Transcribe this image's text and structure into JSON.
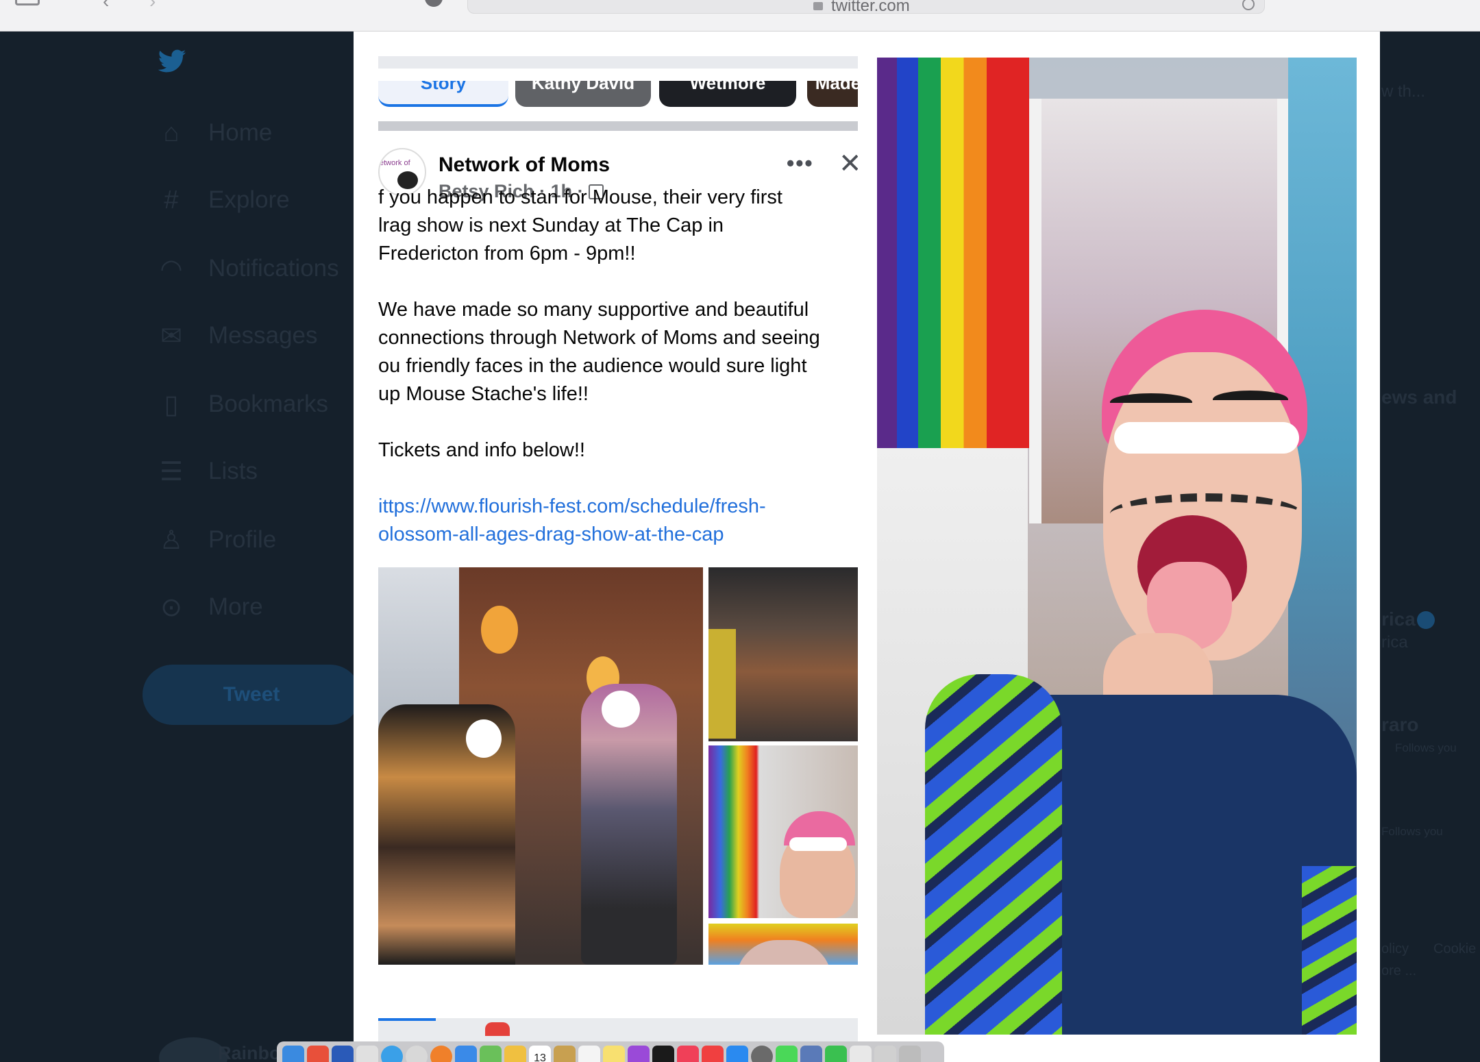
{
  "browser": {
    "url": "twitter.com",
    "icons": [
      "sidebar-icon",
      "back-icon",
      "forward-icon",
      "shield-icon",
      "lock-icon",
      "reload-icon"
    ]
  },
  "twitter": {
    "nav": [
      {
        "label": "Home",
        "icon": "home-icon"
      },
      {
        "label": "Explore",
        "icon": "hashtag-icon"
      },
      {
        "label": "Notifications",
        "icon": "bell-icon"
      },
      {
        "label": "Messages",
        "icon": "envelope-icon"
      },
      {
        "label": "Bookmarks",
        "icon": "bookmark-icon"
      },
      {
        "label": "Lists",
        "icon": "list-icon"
      },
      {
        "label": "Profile",
        "icon": "person-icon"
      },
      {
        "label": "More",
        "icon": "more-circle-icon"
      }
    ],
    "tweet_button": "Tweet",
    "account_name": "Rainbo",
    "right_fragments": {
      "f1": "w th...",
      "news": "ews and",
      "rica": "rica",
      "rica2": "rica",
      "raro": "raro",
      "follows1": "Follows you",
      "follows2": "Follows you",
      "policy": "olicy",
      "cookie": "Cookie",
      "more": "ore ..."
    }
  },
  "fb_post": {
    "stories": [
      "Story",
      "Kathy David",
      "Wetmore",
      "Made"
    ],
    "page_name": "Network of Moms",
    "avatar_text": "etwork of",
    "author": "Betsy Rich",
    "time": "1h",
    "lines": [
      "f you happen to stan for Mouse, their very first",
      "lrag show is next Sunday at The Cap in",
      "Fredericton from 6pm - 9pm!!",
      "We have made so many supportive and beautiful",
      "connections through Network of Moms and seeing",
      "ou friendly faces in the audience would sure light",
      "up Mouse Stache's life!!",
      "Tickets and info below!!"
    ],
    "link_lines": [
      "ittps://www.flourish-fest.com/schedule/fresh-",
      "olossom-all-ages-drag-show-at-the-cap"
    ],
    "more_icon": "more-dots-icon",
    "close_icon": "close-icon"
  },
  "colors": {
    "twitter_bg": "#15202b",
    "link_blue": "#216fdb",
    "fb_text": "#050505",
    "fb_meta": "#65676b"
  },
  "dock": {
    "calendar_day": "13",
    "icons": [
      "finder-icon",
      "vivaldi-icon",
      "word-icon",
      "launchpad-icon",
      "safari-icon",
      "help-icon",
      "firefox-icon",
      "mail-icon",
      "maps-icon",
      "photos-icon",
      "calendar-icon",
      "notes-icon",
      "reminders-icon",
      "stickies-icon",
      "podcasts-icon",
      "tv-icon",
      "music-icon",
      "news-icon",
      "app-store-icon",
      "settings-icon",
      "messages-icon",
      "preview-icon",
      "facetime-icon",
      "documents-icon",
      "folder-icon",
      "trash-icon"
    ]
  }
}
